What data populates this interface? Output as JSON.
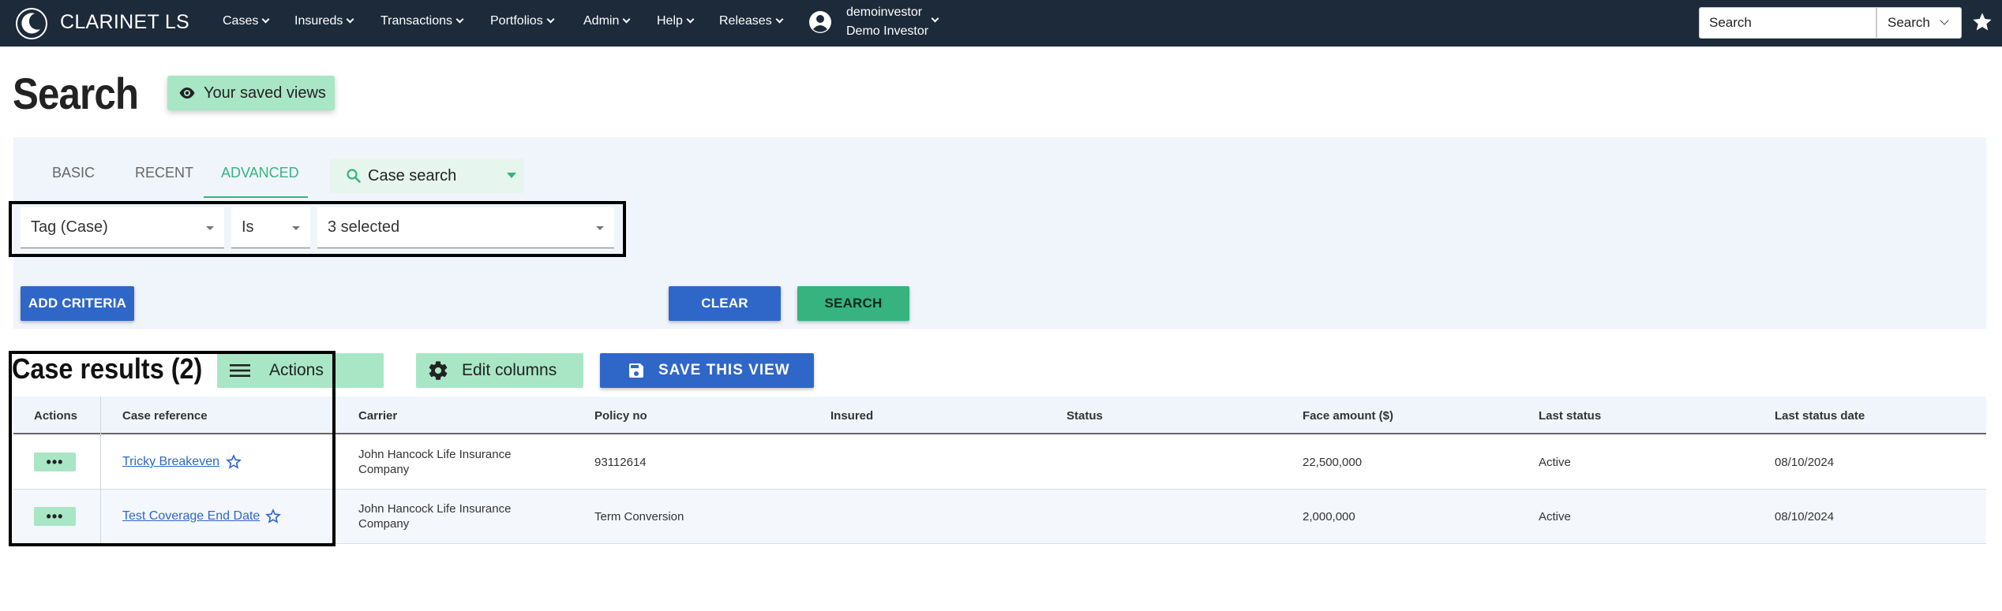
{
  "navbar": {
    "brand": "CLARINET LS",
    "menu": [
      {
        "label": "Cases"
      },
      {
        "label": "Insureds"
      },
      {
        "label": "Transactions"
      },
      {
        "label": "Portfolios"
      },
      {
        "label": "Admin"
      },
      {
        "label": "Help"
      },
      {
        "label": "Releases"
      }
    ],
    "user": {
      "username": "demoinvestor",
      "display_name": "Demo Investor"
    },
    "search": {
      "placeholder": "Search",
      "button_label": "Search"
    },
    "icons": {
      "logo": "clarinet-logo-icon",
      "user": "user-circle-icon",
      "favorite": "star-icon"
    }
  },
  "header": {
    "title": "Search",
    "saved_views_label": "Your saved views"
  },
  "search_panel": {
    "tabs": [
      {
        "label": "BASIC",
        "active": false
      },
      {
        "label": "RECENT",
        "active": false
      },
      {
        "label": "ADVANCED",
        "active": true
      }
    ],
    "search_type": "Case search",
    "criteria": {
      "field": "Tag (Case)",
      "operator": "Is",
      "value": "3 selected"
    },
    "add_criteria_label": "ADD CRITERIA",
    "clear_label": "CLEAR",
    "search_label": "SEARCH"
  },
  "results": {
    "title": "Case results (2)",
    "actions_label": "Actions",
    "edit_columns_label": "Edit columns",
    "save_view_label": "SAVE THIS VIEW",
    "columns": [
      "Actions",
      "Case reference",
      "Carrier",
      "Policy no",
      "Insured",
      "Status",
      "Face amount ($)",
      "Last status",
      "Last status date"
    ],
    "rows": [
      {
        "actions": "•••",
        "case_reference": "Tricky Breakeven",
        "carrier_line1": "John Hancock Life Insurance",
        "carrier_line2": "Company",
        "policy_no": "93112614",
        "insured": "",
        "status": "",
        "face_amount": "22,500,000",
        "last_status": "Active",
        "last_status_date": "08/10/2024"
      },
      {
        "actions": "•••",
        "case_reference": "Test Coverage End Date",
        "carrier_line1": "John Hancock Life Insurance",
        "carrier_line2": "Company",
        "policy_no": "Term Conversion",
        "insured": "",
        "status": "",
        "face_amount": "2,000,000",
        "last_status": "Active",
        "last_status_date": "08/10/2024"
      }
    ]
  },
  "colors": {
    "navbar_bg": "#1c2a3a",
    "accent_green": "#36b37e",
    "light_green": "#a8e6c6",
    "primary_blue": "#2f67c8",
    "panel_bg": "#f0f5fc"
  }
}
